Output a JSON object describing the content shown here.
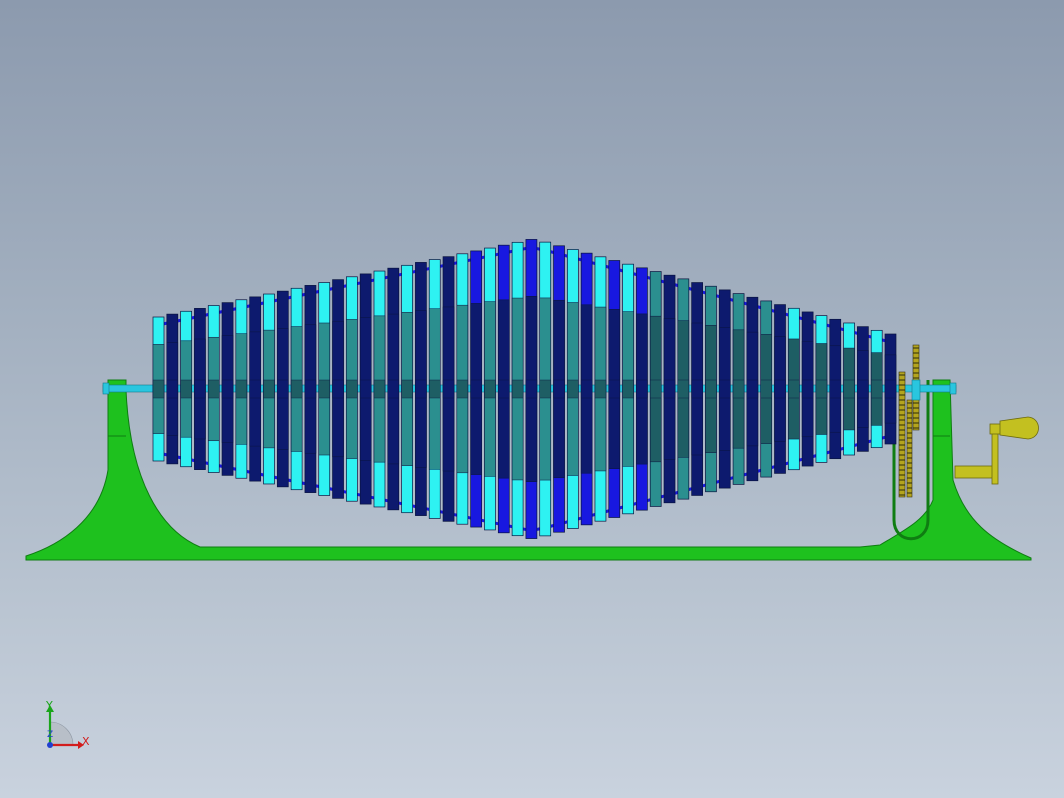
{
  "viewport": {
    "background_top": "#8c9aae",
    "background_bottom": "#c9d2de"
  },
  "model": {
    "colors": {
      "base_frame": "#1ec11e",
      "base_frame_dark": "#0f7d12",
      "shaft": "#29c6df",
      "light_plate": "#2ef2f2",
      "teal_plate": "#2b8f8f",
      "dark_teal_plate": "#1e5e64",
      "blue_plate": "#1818e0",
      "navy_plate": "#0d1a6e",
      "crank": "#c3c020",
      "gear": "#b4a51e"
    },
    "icons": [
      "crank-handle-icon",
      "gear-icon"
    ]
  },
  "triad": {
    "x_label": "X",
    "y_label": "Y",
    "z_label": "Z",
    "x_color": "#d21c1c",
    "y_color": "#1aa51a",
    "z_color": "#2040d0"
  }
}
